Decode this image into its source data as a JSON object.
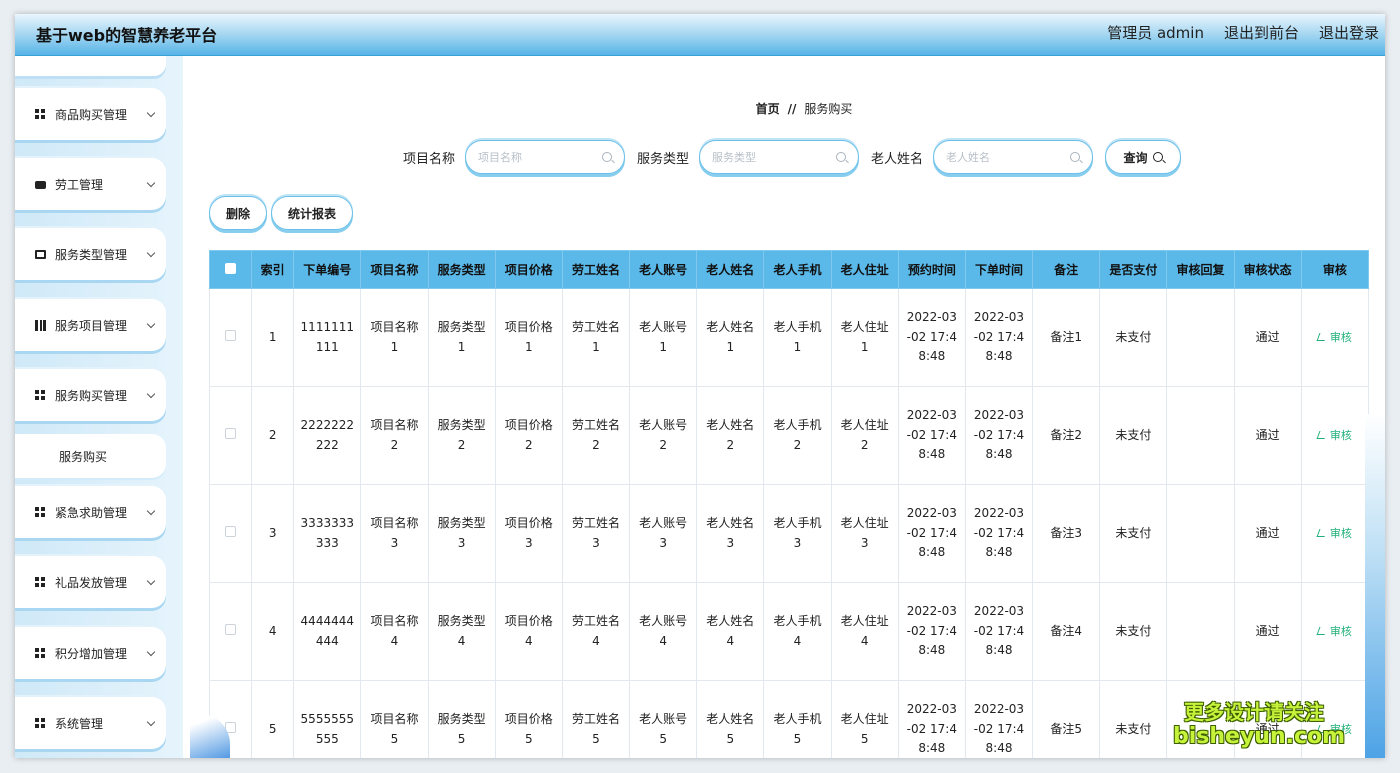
{
  "app": {
    "title": "基于web的智慧养老平台",
    "user_label": "管理员 admin",
    "to_front": "退出到前台",
    "logout": "退出登录"
  },
  "sidebar": {
    "items": [
      {
        "label": "商品购买管理",
        "icon": "grid-icon"
      },
      {
        "label": "劳工管理",
        "icon": "chat-icon"
      },
      {
        "label": "服务类型管理",
        "icon": "bag-icon"
      },
      {
        "label": "服务项目管理",
        "icon": "bars-icon"
      },
      {
        "label": "服务购买管理",
        "icon": "grid-icon"
      },
      {
        "label": "紧急求助管理",
        "icon": "grid-icon"
      },
      {
        "label": "礼品发放管理",
        "icon": "grid-icon"
      },
      {
        "label": "积分增加管理",
        "icon": "grid-icon"
      },
      {
        "label": "系统管理",
        "icon": "grid-icon"
      }
    ],
    "sub_item": "服务购买"
  },
  "breadcrumb": {
    "home": "首页",
    "sep": "//",
    "current": "服务购买"
  },
  "search": {
    "f1_label": "项目名称",
    "f1_placeholder": "项目名称",
    "f2_label": "服务类型",
    "f2_placeholder": "服务类型",
    "f3_label": "老人姓名",
    "f3_placeholder": "老人姓名",
    "query": "查询"
  },
  "actions": {
    "delete": "删除",
    "report": "统计报表"
  },
  "table": {
    "headers": [
      "索引",
      "下单编号",
      "项目名称",
      "服务类型",
      "项目价格",
      "劳工姓名",
      "老人账号",
      "老人姓名",
      "老人手机",
      "老人住址",
      "预约时间",
      "下单时间",
      "备注",
      "是否支付",
      "审核回复",
      "审核状态",
      "审核"
    ],
    "rows": [
      [
        "1",
        "1111111111",
        "项目名称1",
        "服务类型1",
        "项目价格1",
        "劳工姓名1",
        "老人账号1",
        "老人姓名1",
        "老人手机1",
        "老人住址1",
        "2022-03-02 17:48:48",
        "2022-03-02 17:48:48",
        "备注1",
        "未支付",
        "",
        "通过",
        "审核"
      ],
      [
        "2",
        "2222222222",
        "项目名称2",
        "服务类型2",
        "项目价格2",
        "劳工姓名2",
        "老人账号2",
        "老人姓名2",
        "老人手机2",
        "老人住址2",
        "2022-03-02 17:48:48",
        "2022-03-02 17:48:48",
        "备注2",
        "未支付",
        "",
        "通过",
        "审核"
      ],
      [
        "3",
        "3333333333",
        "项目名称3",
        "服务类型3",
        "项目价格3",
        "劳工姓名3",
        "老人账号3",
        "老人姓名3",
        "老人手机3",
        "老人住址3",
        "2022-03-02 17:48:48",
        "2022-03-02 17:48:48",
        "备注3",
        "未支付",
        "",
        "通过",
        "审核"
      ],
      [
        "4",
        "4444444444",
        "项目名称4",
        "服务类型4",
        "项目价格4",
        "劳工姓名4",
        "老人账号4",
        "老人姓名4",
        "老人手机4",
        "老人住址4",
        "2022-03-02 17:48:48",
        "2022-03-02 17:48:48",
        "备注4",
        "未支付",
        "",
        "通过",
        "审核"
      ],
      [
        "5",
        "5555555555",
        "项目名称5",
        "服务类型5",
        "项目价格5",
        "劳工姓名5",
        "老人账号5",
        "老人姓名5",
        "老人手机5",
        "老人住址5",
        "2022-03-02 17:48:48",
        "2022-03-02 17:48:48",
        "备注5",
        "未支付",
        "",
        "通过",
        "审核"
      ]
    ]
  },
  "watermark": {
    "line1": "更多设计请关注",
    "line2": "bisheyun.com"
  },
  "colors": {
    "accent": "#5ab9e9",
    "link": "#22b07a"
  }
}
